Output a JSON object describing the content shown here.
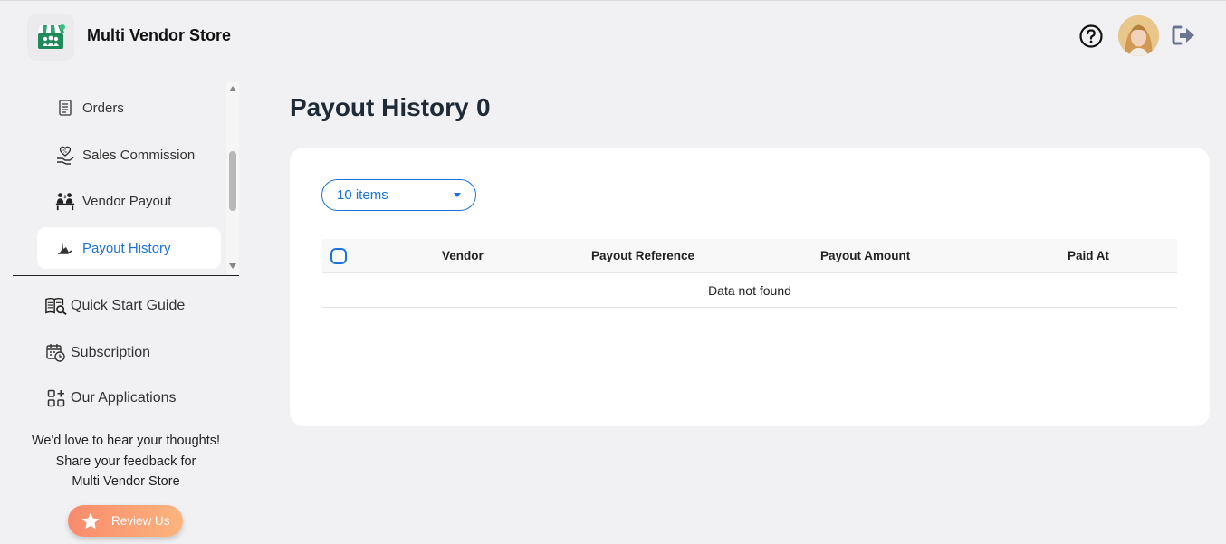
{
  "app": {
    "title": "Multi Vendor Store"
  },
  "header": {
    "help_icon": "question-circle-icon",
    "avatar_icon": "user-avatar",
    "logout_icon": "logout-icon"
  },
  "sidebar": {
    "items": [
      {
        "label": "Orders",
        "icon": "orders-list-icon",
        "active": false
      },
      {
        "label": "Sales Commission",
        "icon": "commission-heart-icon",
        "active": false
      },
      {
        "label": "Vendor Payout",
        "icon": "vendor-payout-icon",
        "active": false
      },
      {
        "label": "Payout History",
        "icon": "payout-history-icon",
        "active": true
      }
    ],
    "secondary": [
      {
        "label": "Quick Start Guide",
        "icon": "book-search-icon"
      },
      {
        "label": "Subscription",
        "icon": "calendar-clock-icon"
      },
      {
        "label": "Our Applications",
        "icon": "apps-grid-icon"
      }
    ],
    "feedback": {
      "line1": "We'd love to hear your thoughts!",
      "line2": "Share your feedback for",
      "line3": "Multi Vendor Store",
      "button": "Review Us"
    }
  },
  "main": {
    "title": "Payout History",
    "count": "0",
    "page_size": "10 items",
    "columns": [
      "Vendor",
      "Payout Reference",
      "Payout Amount",
      "Paid At"
    ],
    "empty_text": "Data not found"
  },
  "colors": {
    "accent": "#1a73d9",
    "background": "#f1f1f3",
    "review_gradient_start": "#f98a6c",
    "review_gradient_end": "#fbb57e"
  }
}
